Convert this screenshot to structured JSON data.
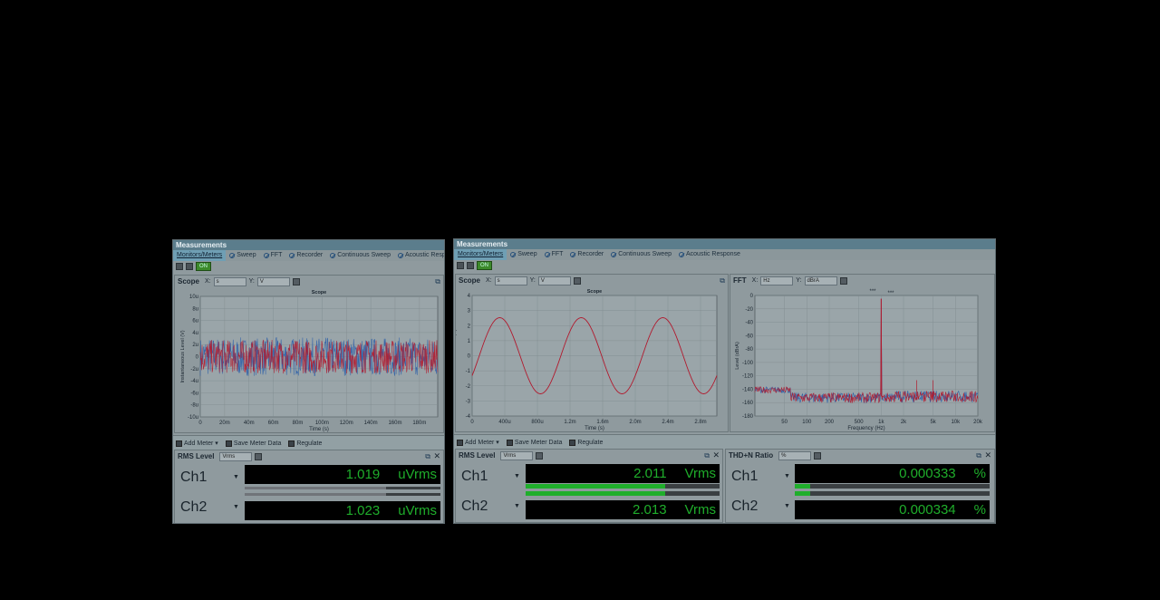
{
  "window_title": "Measurements",
  "tabs": [
    "Monitors/Meters",
    "Sweep",
    "FFT",
    "Recorder",
    "Continuous Sweep",
    "Acoustic Response"
  ],
  "toolbar": {
    "on_label": "ON"
  },
  "meter_toolbar": {
    "add_meter": "Add Meter",
    "save_meter_data": "Save Meter Data",
    "regulate": "Regulate"
  },
  "left": {
    "scope": {
      "name": "Scope",
      "x_label": "X:",
      "x_unit": "s",
      "y_label": "Y:",
      "y_unit": "V",
      "chart_title": "Scope",
      "chart_data": {
        "type": "line",
        "title": "Scope",
        "xlabel": "Time (s)",
        "ylabel": "Instantaneous Level (V)",
        "xlim": [
          0,
          195
        ],
        "ylim": [
          -10,
          10
        ],
        "x_ticks": [
          "0",
          "20m",
          "40m",
          "60m",
          "80m",
          "100m",
          "120m",
          "140m",
          "160m",
          "180m"
        ],
        "y_ticks": [
          "10u",
          "8u",
          "6u",
          "4u",
          "2u",
          "0",
          "-2u",
          "-4u",
          "-6u",
          "-8u",
          "-10u"
        ],
        "series": [
          {
            "values": [
              0
            ]
          },
          {
            "values": [
              0
            ]
          }
        ],
        "colors": [
          "#2c5fa8",
          "#b11a2e"
        ]
      }
    },
    "meter": {
      "name": "RMS Level",
      "unit_select": "Vrms",
      "ch1": {
        "label": "Ch1",
        "value": "1.019",
        "unit": "uVrms",
        "bar_fraction": 0.72
      },
      "ch2": {
        "label": "Ch2",
        "value": "1.023",
        "unit": "uVrms",
        "bar_fraction": 0.72
      }
    }
  },
  "right": {
    "scope": {
      "name": "Scope",
      "x_label": "X:",
      "x_unit": "s",
      "y_label": "Y:",
      "y_unit": "V",
      "chart_title": "Scope",
      "chart_data": {
        "type": "line",
        "title": "Scope",
        "xlabel": "Time (s)",
        "ylabel": "Instantaneous Level (V)",
        "xlim": [
          0,
          3.0
        ],
        "ylim": [
          -4.5,
          4.5
        ],
        "x_ticks": [
          "0",
          "400u",
          "800u",
          "1.2m",
          "1.6m",
          "2.0m",
          "2.4m",
          "2.8m"
        ],
        "y_ticks": [
          "4",
          "3",
          "2",
          "1",
          "0",
          "-1",
          "-2",
          "-3",
          "-4"
        ],
        "series": [
          {
            "amplitude": 2.84,
            "frequency_per_ms": 1.0
          }
        ],
        "colors": [
          "#b11a2e"
        ]
      }
    },
    "fft": {
      "name": "FFT",
      "x_label": "X:",
      "x_unit": "Hz",
      "y_label": "Y:",
      "y_unit": "dBrA",
      "legend": [
        "***",
        "***"
      ],
      "chart_data": {
        "type": "line",
        "xlabel": "Frequency (Hz)",
        "ylabel": "Level (dBrA)",
        "x_scale": "log",
        "xlim": [
          20,
          20000
        ],
        "ylim": [
          -180,
          5
        ],
        "x_ticks": [
          "50",
          "100",
          "200",
          "500",
          "1k",
          "2k",
          "5k",
          "10k",
          "20k"
        ],
        "y_ticks": [
          "0",
          "-20",
          "-40",
          "-60",
          "-80",
          "-100",
          "-120",
          "-140",
          "-160",
          "-180"
        ],
        "series": [
          {
            "peak_frequency": 1000,
            "peak_level": 0
          }
        ],
        "colors": [
          "#2c5fa8",
          "#b11a2e"
        ]
      }
    },
    "rms_meter": {
      "name": "RMS Level",
      "unit_select": "Vrms",
      "ch1": {
        "label": "Ch1",
        "value": "2.011",
        "unit": "Vrms",
        "bar_fraction": 0.72
      },
      "ch2": {
        "label": "Ch2",
        "value": "2.013",
        "unit": "Vrms",
        "bar_fraction": 0.72
      }
    },
    "thd_meter": {
      "name": "THD+N Ratio",
      "unit_select": "%",
      "ch1": {
        "label": "Ch1",
        "value": "0.000333",
        "unit": "%",
        "bar_fraction": 0.08
      },
      "ch2": {
        "label": "Ch2",
        "value": "0.000334",
        "unit": "%",
        "bar_fraction": 0.08
      }
    }
  }
}
